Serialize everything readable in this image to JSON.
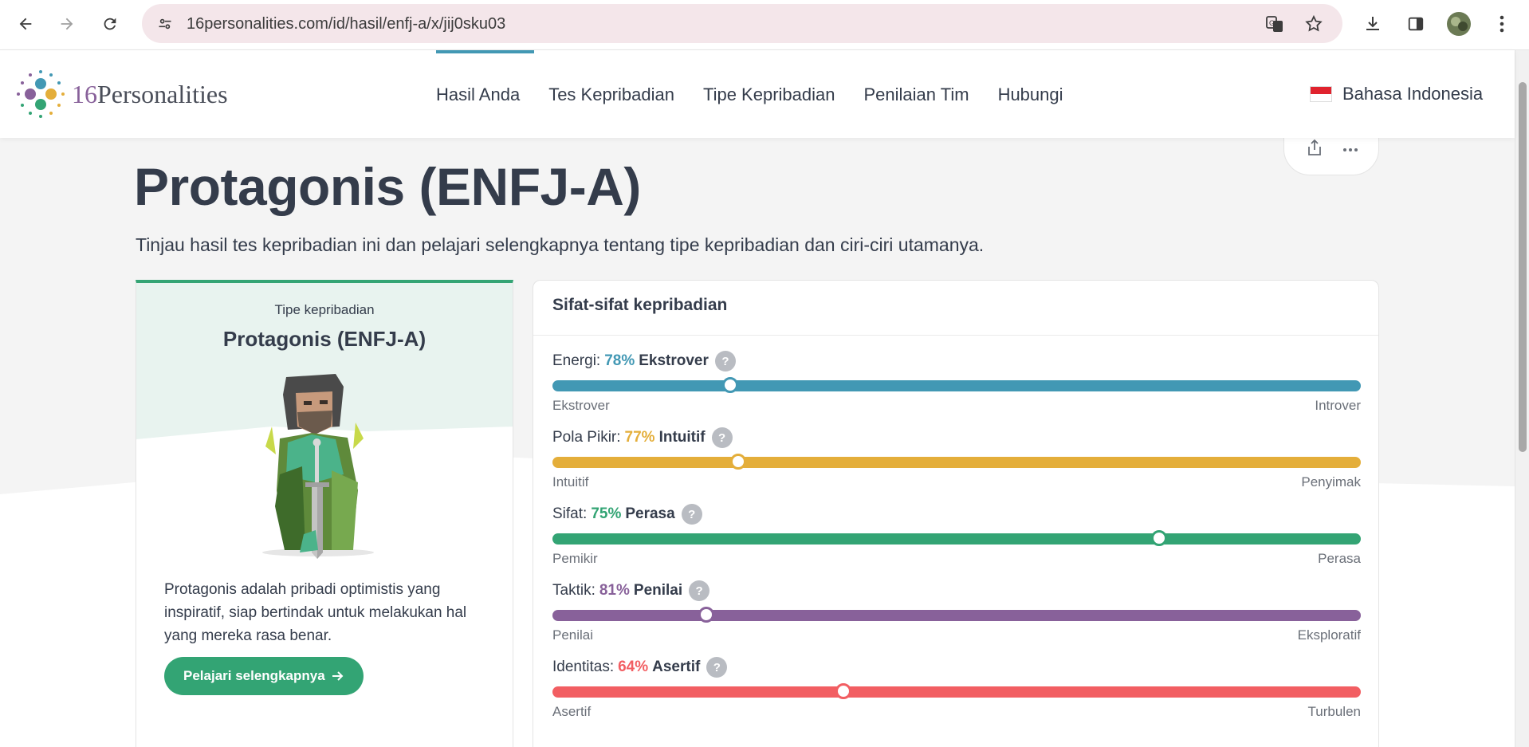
{
  "browser": {
    "url": "16personalities.com/id/hasil/enfj-a/x/jij0sku03"
  },
  "site": {
    "logo_number": "16",
    "logo_word": "Personalities",
    "nav": [
      "Hasil Anda",
      "Tes Kepribadian",
      "Tipe Kepribadian",
      "Penilaian Tim",
      "Hubungi"
    ],
    "language": "Bahasa Indonesia"
  },
  "page": {
    "title": "Protagonis (ENFJ-A)",
    "intro": "Tinjau hasil tes kepribadian ini dan pelajari selengkapnya tentang tipe kepribadian dan ciri-ciri utamanya."
  },
  "type_card": {
    "kicker": "Tipe kepribadian",
    "name": "Protagonis (ENFJ-A)",
    "description": "Protagonis adalah pribadi optimistis yang inspiratif, siap bertindak untuk melakukan hal yang mereka rasa benar.",
    "button": "Pelajari selengkapnya"
  },
  "traits": {
    "heading": "Sifat-sifat kepribadian",
    "items": [
      {
        "label": "Energi:",
        "percent": "78%",
        "name": "Ekstrover",
        "left": "Ekstrover",
        "right": "Introver",
        "position": 0.22,
        "color": "#4298b4"
      },
      {
        "label": "Pola Pikir:",
        "percent": "77%",
        "name": "Intuitif",
        "left": "Intuitif",
        "right": "Penyimak",
        "position": 0.23,
        "color": "#e4ae3a"
      },
      {
        "label": "Sifat:",
        "percent": "75%",
        "name": "Perasa",
        "left": "Pemikir",
        "right": "Perasa",
        "position": 0.75,
        "color": "#33a474"
      },
      {
        "label": "Taktik:",
        "percent": "81%",
        "name": "Penilai",
        "left": "Penilai",
        "right": "Eksploratif",
        "position": 0.19,
        "color": "#88619a"
      },
      {
        "label": "Identitas:",
        "percent": "64%",
        "name": "Asertif",
        "left": "Asertif",
        "right": "Turbulen",
        "position": 0.36,
        "color": "#f25e62"
      }
    ]
  }
}
